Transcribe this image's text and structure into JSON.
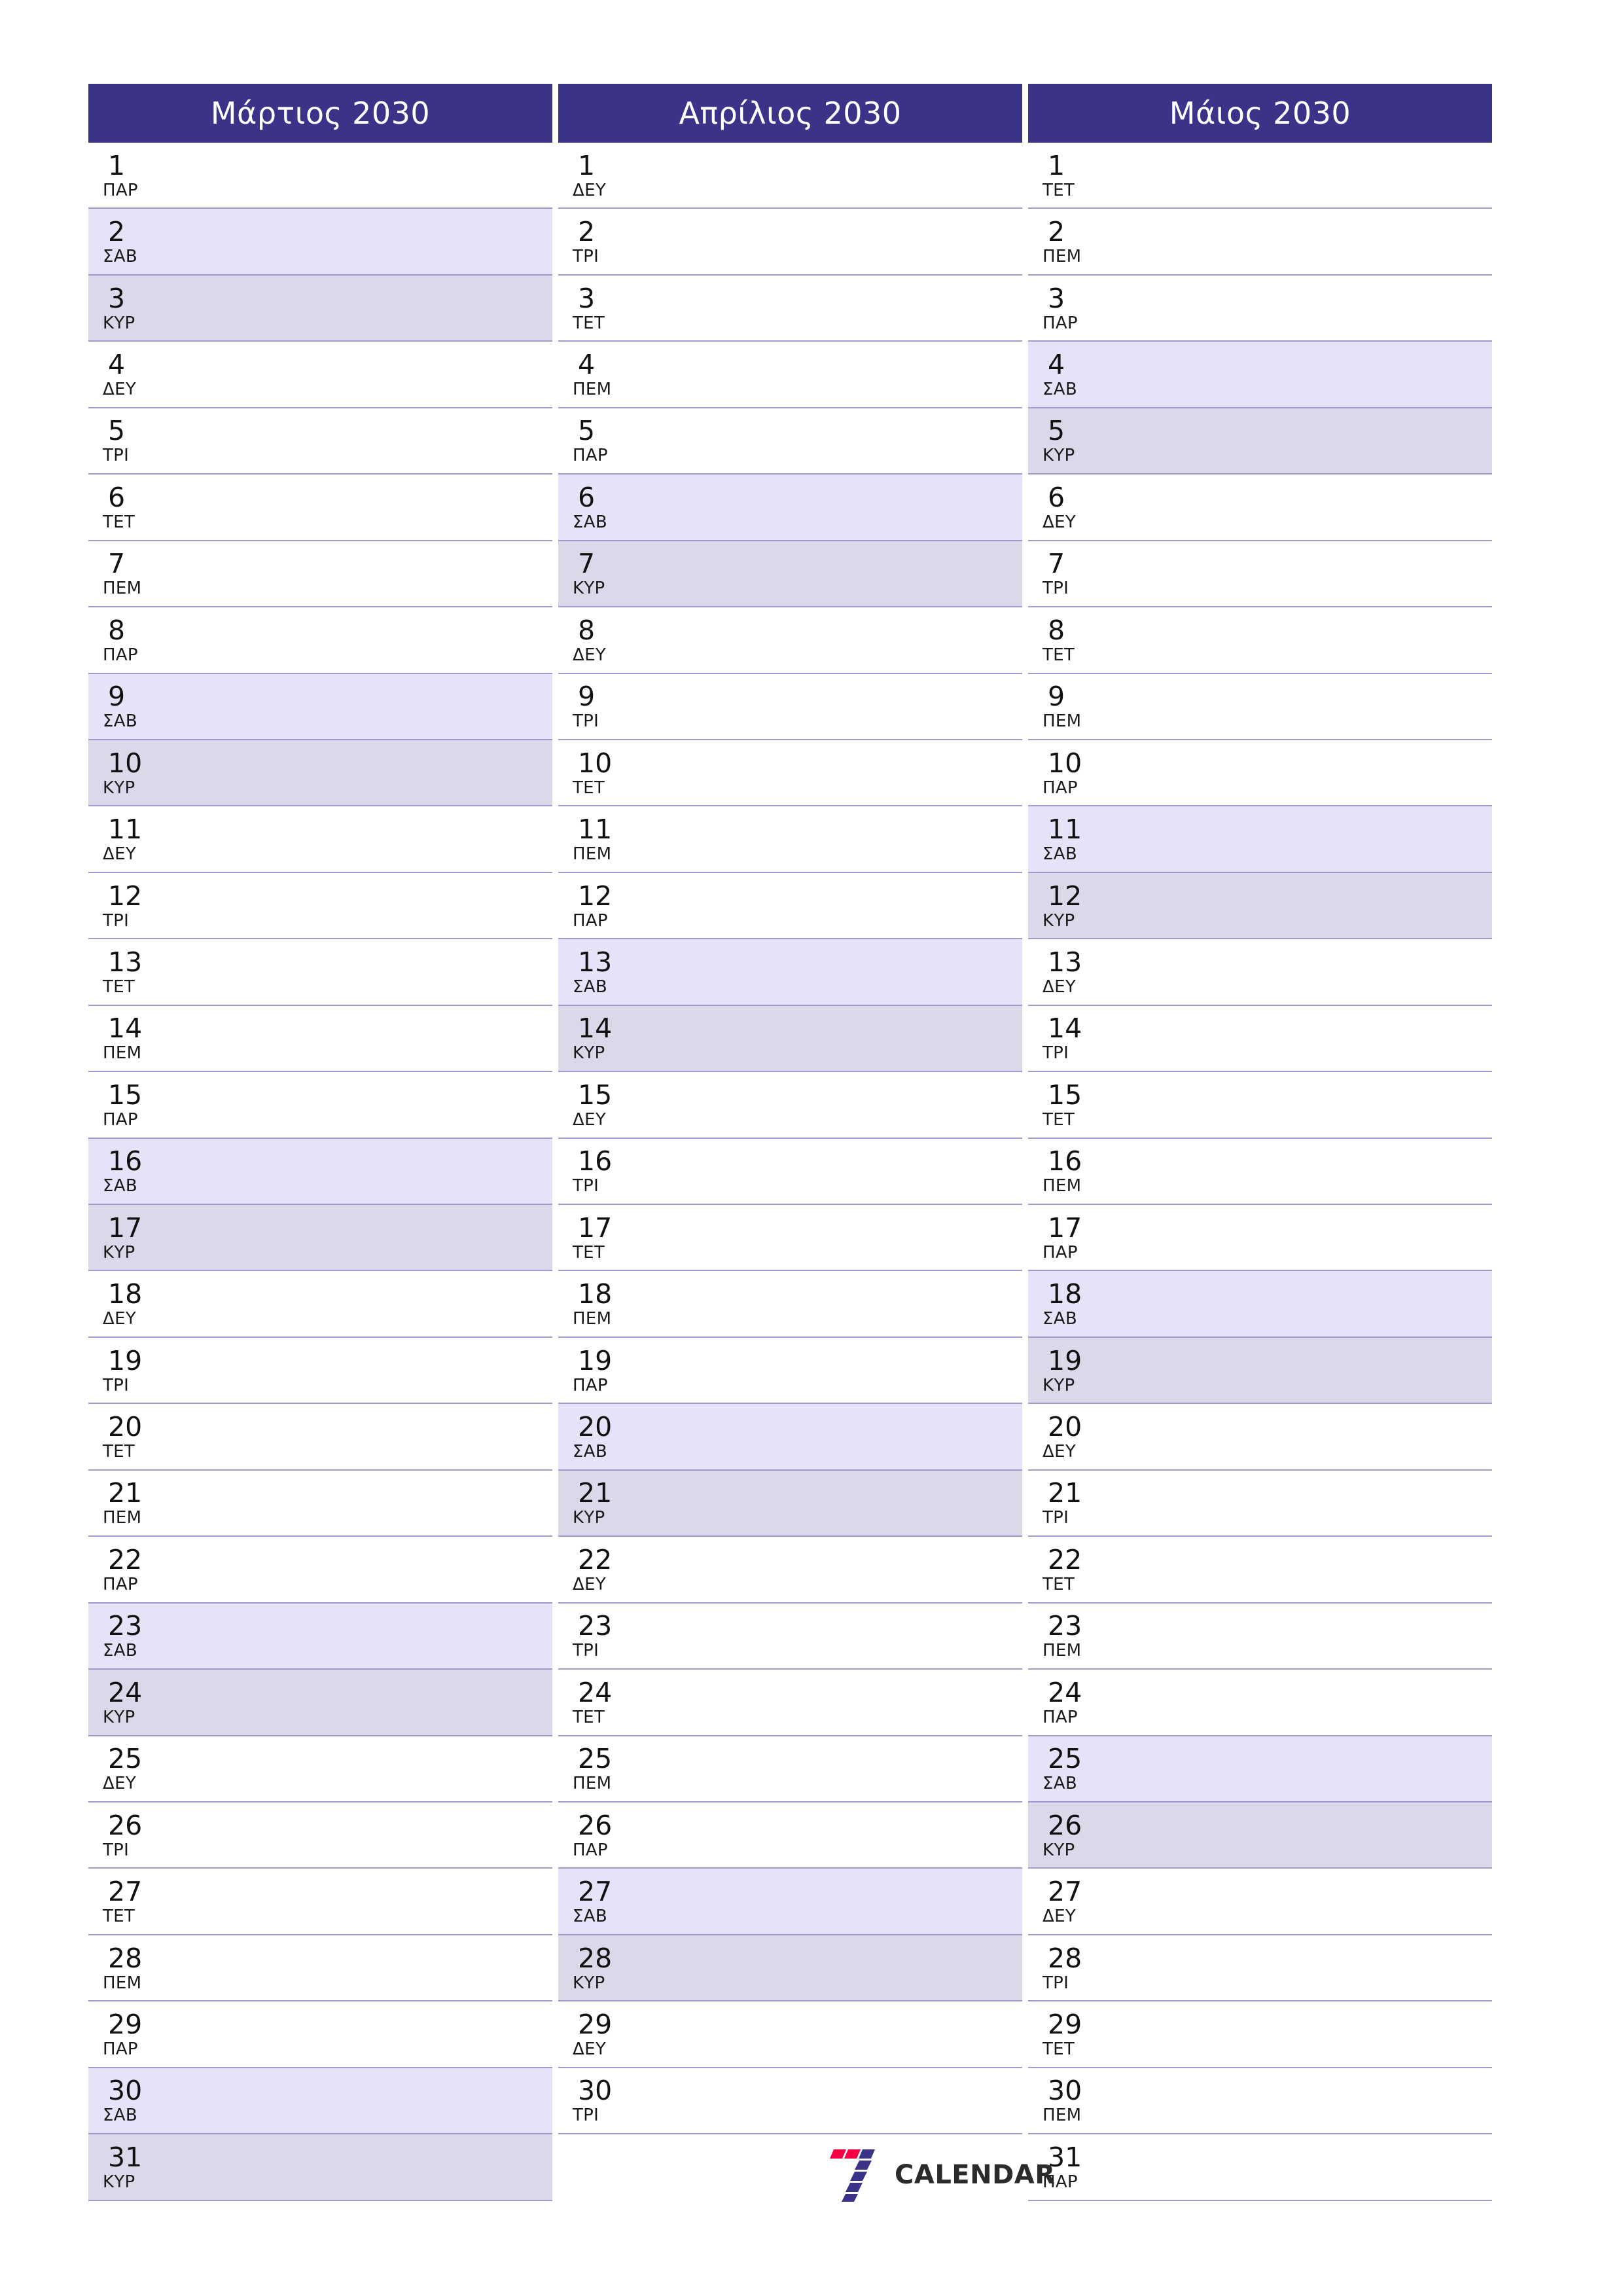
{
  "colors": {
    "header_bg": "#3b3387",
    "header_text": "#ffffff",
    "saturday_bg": "#e4e3f7",
    "sunday_bg": "#dcd8ea",
    "row_divider": "#a099cc",
    "logo_red": "#f50040",
    "logo_purple": "#3b3387",
    "logo_wordmark": "#2b2b2e",
    "page_bg": "#ffffff"
  },
  "brand": {
    "wordmark": "CALENDAR",
    "mark_alt": "7"
  },
  "months": [
    {
      "title": "Μάρτιος 2030",
      "days": [
        {
          "num": "1",
          "name": "ΠΑΡ",
          "kind": "weekday"
        },
        {
          "num": "2",
          "name": "ΣΑΒ",
          "kind": "sat"
        },
        {
          "num": "3",
          "name": "ΚΥΡ",
          "kind": "sun"
        },
        {
          "num": "4",
          "name": "ΔΕΥ",
          "kind": "weekday"
        },
        {
          "num": "5",
          "name": "ΤΡΙ",
          "kind": "weekday"
        },
        {
          "num": "6",
          "name": "ΤΕΤ",
          "kind": "weekday"
        },
        {
          "num": "7",
          "name": "ΠΕΜ",
          "kind": "weekday"
        },
        {
          "num": "8",
          "name": "ΠΑΡ",
          "kind": "weekday"
        },
        {
          "num": "9",
          "name": "ΣΑΒ",
          "kind": "sat"
        },
        {
          "num": "10",
          "name": "ΚΥΡ",
          "kind": "sun"
        },
        {
          "num": "11",
          "name": "ΔΕΥ",
          "kind": "weekday"
        },
        {
          "num": "12",
          "name": "ΤΡΙ",
          "kind": "weekday"
        },
        {
          "num": "13",
          "name": "ΤΕΤ",
          "kind": "weekday"
        },
        {
          "num": "14",
          "name": "ΠΕΜ",
          "kind": "weekday"
        },
        {
          "num": "15",
          "name": "ΠΑΡ",
          "kind": "weekday"
        },
        {
          "num": "16",
          "name": "ΣΑΒ",
          "kind": "sat"
        },
        {
          "num": "17",
          "name": "ΚΥΡ",
          "kind": "sun"
        },
        {
          "num": "18",
          "name": "ΔΕΥ",
          "kind": "weekday"
        },
        {
          "num": "19",
          "name": "ΤΡΙ",
          "kind": "weekday"
        },
        {
          "num": "20",
          "name": "ΤΕΤ",
          "kind": "weekday"
        },
        {
          "num": "21",
          "name": "ΠΕΜ",
          "kind": "weekday"
        },
        {
          "num": "22",
          "name": "ΠΑΡ",
          "kind": "weekday"
        },
        {
          "num": "23",
          "name": "ΣΑΒ",
          "kind": "sat"
        },
        {
          "num": "24",
          "name": "ΚΥΡ",
          "kind": "sun"
        },
        {
          "num": "25",
          "name": "ΔΕΥ",
          "kind": "weekday"
        },
        {
          "num": "26",
          "name": "ΤΡΙ",
          "kind": "weekday"
        },
        {
          "num": "27",
          "name": "ΤΕΤ",
          "kind": "weekday"
        },
        {
          "num": "28",
          "name": "ΠΕΜ",
          "kind": "weekday"
        },
        {
          "num": "29",
          "name": "ΠΑΡ",
          "kind": "weekday"
        },
        {
          "num": "30",
          "name": "ΣΑΒ",
          "kind": "sat"
        },
        {
          "num": "31",
          "name": "ΚΥΡ",
          "kind": "sun"
        }
      ]
    },
    {
      "title": "Απρίλιος 2030",
      "days": [
        {
          "num": "1",
          "name": "ΔΕΥ",
          "kind": "weekday"
        },
        {
          "num": "2",
          "name": "ΤΡΙ",
          "kind": "weekday"
        },
        {
          "num": "3",
          "name": "ΤΕΤ",
          "kind": "weekday"
        },
        {
          "num": "4",
          "name": "ΠΕΜ",
          "kind": "weekday"
        },
        {
          "num": "5",
          "name": "ΠΑΡ",
          "kind": "weekday"
        },
        {
          "num": "6",
          "name": "ΣΑΒ",
          "kind": "sat"
        },
        {
          "num": "7",
          "name": "ΚΥΡ",
          "kind": "sun"
        },
        {
          "num": "8",
          "name": "ΔΕΥ",
          "kind": "weekday"
        },
        {
          "num": "9",
          "name": "ΤΡΙ",
          "kind": "weekday"
        },
        {
          "num": "10",
          "name": "ΤΕΤ",
          "kind": "weekday"
        },
        {
          "num": "11",
          "name": "ΠΕΜ",
          "kind": "weekday"
        },
        {
          "num": "12",
          "name": "ΠΑΡ",
          "kind": "weekday"
        },
        {
          "num": "13",
          "name": "ΣΑΒ",
          "kind": "sat"
        },
        {
          "num": "14",
          "name": "ΚΥΡ",
          "kind": "sun"
        },
        {
          "num": "15",
          "name": "ΔΕΥ",
          "kind": "weekday"
        },
        {
          "num": "16",
          "name": "ΤΡΙ",
          "kind": "weekday"
        },
        {
          "num": "17",
          "name": "ΤΕΤ",
          "kind": "weekday"
        },
        {
          "num": "18",
          "name": "ΠΕΜ",
          "kind": "weekday"
        },
        {
          "num": "19",
          "name": "ΠΑΡ",
          "kind": "weekday"
        },
        {
          "num": "20",
          "name": "ΣΑΒ",
          "kind": "sat"
        },
        {
          "num": "21",
          "name": "ΚΥΡ",
          "kind": "sun"
        },
        {
          "num": "22",
          "name": "ΔΕΥ",
          "kind": "weekday"
        },
        {
          "num": "23",
          "name": "ΤΡΙ",
          "kind": "weekday"
        },
        {
          "num": "24",
          "name": "ΤΕΤ",
          "kind": "weekday"
        },
        {
          "num": "25",
          "name": "ΠΕΜ",
          "kind": "weekday"
        },
        {
          "num": "26",
          "name": "ΠΑΡ",
          "kind": "weekday"
        },
        {
          "num": "27",
          "name": "ΣΑΒ",
          "kind": "sat"
        },
        {
          "num": "28",
          "name": "ΚΥΡ",
          "kind": "sun"
        },
        {
          "num": "29",
          "name": "ΔΕΥ",
          "kind": "weekday"
        },
        {
          "num": "30",
          "name": "ΤΡΙ",
          "kind": "weekday"
        }
      ]
    },
    {
      "title": "Μάιος 2030",
      "days": [
        {
          "num": "1",
          "name": "ΤΕΤ",
          "kind": "weekday"
        },
        {
          "num": "2",
          "name": "ΠΕΜ",
          "kind": "weekday"
        },
        {
          "num": "3",
          "name": "ΠΑΡ",
          "kind": "weekday"
        },
        {
          "num": "4",
          "name": "ΣΑΒ",
          "kind": "sat"
        },
        {
          "num": "5",
          "name": "ΚΥΡ",
          "kind": "sun"
        },
        {
          "num": "6",
          "name": "ΔΕΥ",
          "kind": "weekday"
        },
        {
          "num": "7",
          "name": "ΤΡΙ",
          "kind": "weekday"
        },
        {
          "num": "8",
          "name": "ΤΕΤ",
          "kind": "weekday"
        },
        {
          "num": "9",
          "name": "ΠΕΜ",
          "kind": "weekday"
        },
        {
          "num": "10",
          "name": "ΠΑΡ",
          "kind": "weekday"
        },
        {
          "num": "11",
          "name": "ΣΑΒ",
          "kind": "sat"
        },
        {
          "num": "12",
          "name": "ΚΥΡ",
          "kind": "sun"
        },
        {
          "num": "13",
          "name": "ΔΕΥ",
          "kind": "weekday"
        },
        {
          "num": "14",
          "name": "ΤΡΙ",
          "kind": "weekday"
        },
        {
          "num": "15",
          "name": "ΤΕΤ",
          "kind": "weekday"
        },
        {
          "num": "16",
          "name": "ΠΕΜ",
          "kind": "weekday"
        },
        {
          "num": "17",
          "name": "ΠΑΡ",
          "kind": "weekday"
        },
        {
          "num": "18",
          "name": "ΣΑΒ",
          "kind": "sat"
        },
        {
          "num": "19",
          "name": "ΚΥΡ",
          "kind": "sun"
        },
        {
          "num": "20",
          "name": "ΔΕΥ",
          "kind": "weekday"
        },
        {
          "num": "21",
          "name": "ΤΡΙ",
          "kind": "weekday"
        },
        {
          "num": "22",
          "name": "ΤΕΤ",
          "kind": "weekday"
        },
        {
          "num": "23",
          "name": "ΠΕΜ",
          "kind": "weekday"
        },
        {
          "num": "24",
          "name": "ΠΑΡ",
          "kind": "weekday"
        },
        {
          "num": "25",
          "name": "ΣΑΒ",
          "kind": "sat"
        },
        {
          "num": "26",
          "name": "ΚΥΡ",
          "kind": "sun"
        },
        {
          "num": "27",
          "name": "ΔΕΥ",
          "kind": "weekday"
        },
        {
          "num": "28",
          "name": "ΤΡΙ",
          "kind": "weekday"
        },
        {
          "num": "29",
          "name": "ΤΕΤ",
          "kind": "weekday"
        },
        {
          "num": "30",
          "name": "ΠΕΜ",
          "kind": "weekday"
        },
        {
          "num": "31",
          "name": "ΠΑΡ",
          "kind": "weekday"
        }
      ]
    }
  ]
}
